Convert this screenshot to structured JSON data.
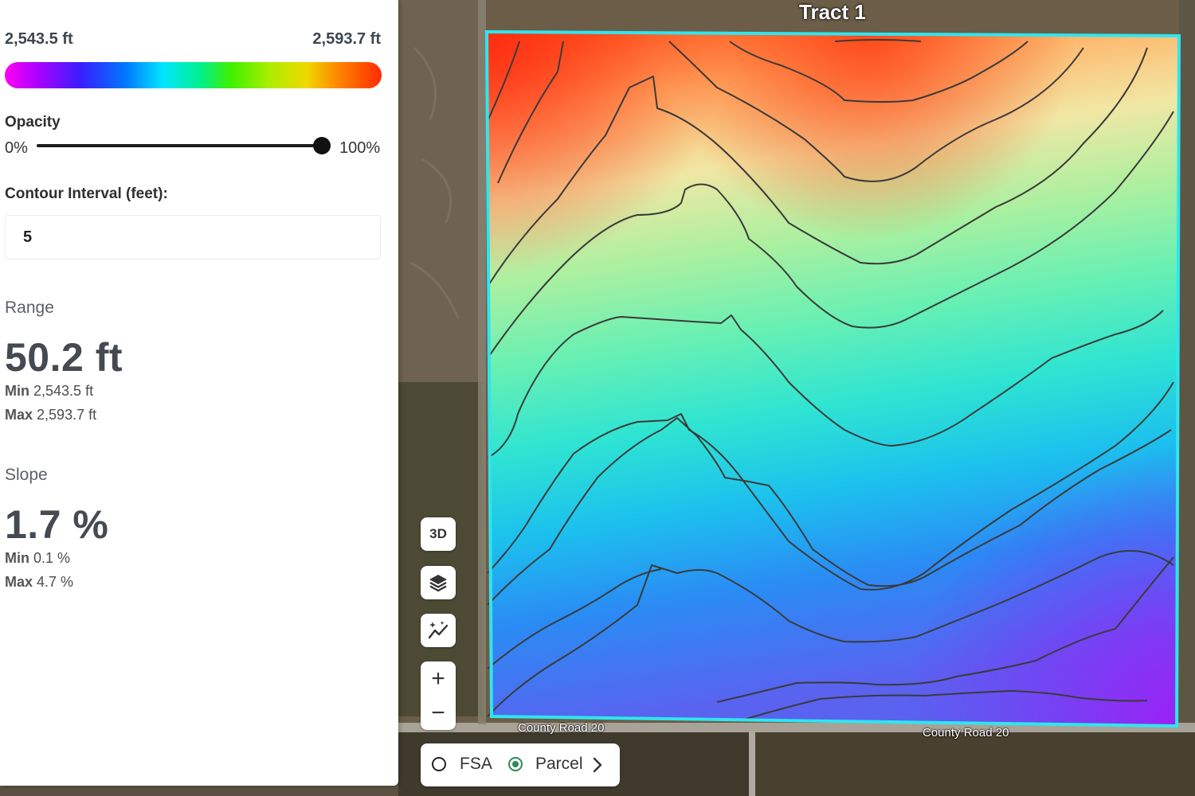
{
  "legend": {
    "min_label": "2,543.5 ft",
    "max_label": "2,593.7 ft",
    "gradient_colors": [
      "#ff00f2",
      "#3a1dff",
      "#00e6ff",
      "#3ef000",
      "#f1d800",
      "#ff2a00"
    ]
  },
  "opacity": {
    "label": "Opacity",
    "min_label": "0%",
    "max_label": "100%",
    "value_percent": 100
  },
  "contour_interval": {
    "label": "Contour Interval (feet):",
    "value": "5"
  },
  "range": {
    "title": "Range",
    "value": "50.2 ft",
    "min_key": "Min",
    "min_value": "2,543.5 ft",
    "max_key": "Max",
    "max_value": "2,593.7 ft"
  },
  "slope": {
    "title": "Slope",
    "value": "1.7 %",
    "min_key": "Min",
    "min_value": "0.1 %",
    "max_key": "Max",
    "max_value": "4.7 %"
  },
  "map": {
    "tract_label": "Tract 1",
    "road_label_left": "County Road 20",
    "road_label_right": "County Road 20",
    "boundary_color": "#2ee6f0"
  },
  "controls": {
    "three_d_label": "3D",
    "layers_icon": "layers-icon",
    "analyze_icon": "sparkle-line-chart-icon",
    "zoom_in_label": "+",
    "zoom_out_label": "−"
  },
  "boundary_toggle": {
    "options": [
      "FSA",
      "Parcel"
    ],
    "selected": "Parcel"
  }
}
